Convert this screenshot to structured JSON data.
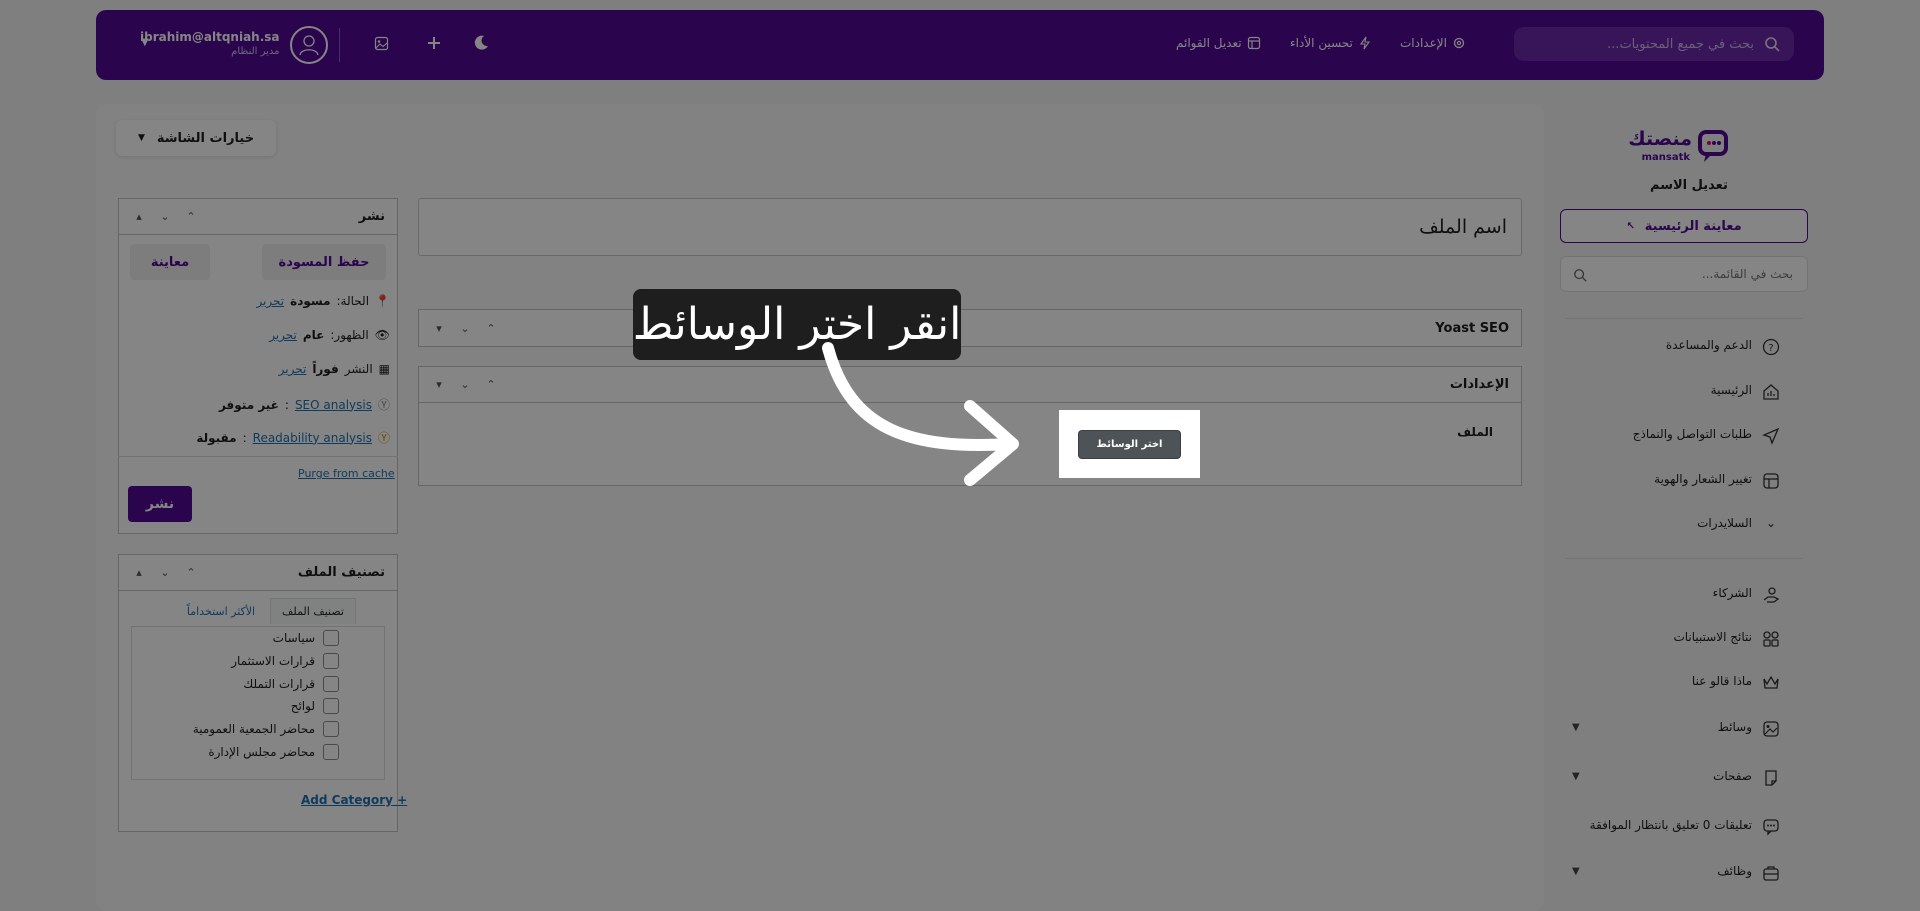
{
  "topbar": {
    "search_placeholder": "بحث في جميع المحتويات...",
    "links": [
      {
        "label": "الإعدادات",
        "icon": "gear-icon"
      },
      {
        "label": "تحسين الأداء",
        "icon": "bolt-icon"
      },
      {
        "label": "تعديل القوائم",
        "icon": "layout-icon"
      }
    ],
    "user": {
      "email": "ibrahim@altqniah.sa",
      "role": "مدير النظام"
    }
  },
  "screen_options": "خيارات الشاشة",
  "editor": {
    "title_placeholder": "اسم الملف",
    "boxes": [
      {
        "title": "Yoast SEO"
      },
      {
        "title": "الإعدادات",
        "field_label": "الملف"
      }
    ]
  },
  "publish_box": {
    "title": "نشر",
    "save_draft": "حفظ المسودة",
    "preview": "معاينة",
    "status_label": "الحالة:",
    "status_value": "مسودة",
    "visibility_label": "الظهور:",
    "visibility_value": "عام",
    "publish_label": "النشر",
    "publish_value": "فوراً",
    "edit": "تحرير",
    "seo_link": "SEO analysis",
    "seo_value": "غير متوفر",
    "readability_link": "Readability analysis",
    "readability_value": "مقبولة",
    "purge": "Purge from cache",
    "publish_button": "نشر"
  },
  "category_box": {
    "title": "تصنيف الملف",
    "tabs": [
      "تصنيف الملف",
      "الأكثر استخداماً"
    ],
    "items": [
      "سياسات",
      "قرارات الاستثمار",
      "قرارات التملك",
      "لوائح",
      "محاضر الجمعية العمومية",
      "محاضر مجلس الإدارة"
    ],
    "add_category": "+ Add Category"
  },
  "sidebar": {
    "logo_ar": "منصتك",
    "logo_en": "mansatk",
    "edit_name": "تعديل الاسم",
    "home_preview": "معاينة الرئيسية",
    "search_placeholder": "بحث في القائمة...",
    "items": [
      {
        "label": "الدعم والمساعدة",
        "icon": "help-icon"
      },
      {
        "label": "الرئيسية",
        "icon": "chart-icon"
      },
      {
        "label": "طلبات التواصل والنماذج",
        "icon": "send-icon"
      },
      {
        "label": "تغيير الشعار والهوية",
        "icon": "layout-icon"
      },
      {
        "label": "السلايدرات",
        "icon": "chevron-down-icon"
      },
      {
        "label": "الشركاء",
        "icon": "partners-icon"
      },
      {
        "label": "نتائج الاستبيانات",
        "icon": "grid-icon"
      },
      {
        "label": "ماذا قالو عنا",
        "icon": "crown-icon"
      },
      {
        "label": "وسائط",
        "icon": "image-icon"
      },
      {
        "label": "صفحات",
        "icon": "page-icon"
      },
      {
        "label": "تعليقات 0 تعليق بانتظار الموافقة",
        "icon": "comment-icon"
      },
      {
        "label": "وظائف",
        "icon": "briefcase-icon"
      }
    ]
  },
  "guide": {
    "callout": "انقر اختر الوسائط",
    "media_button": "اختر الوسائط"
  }
}
